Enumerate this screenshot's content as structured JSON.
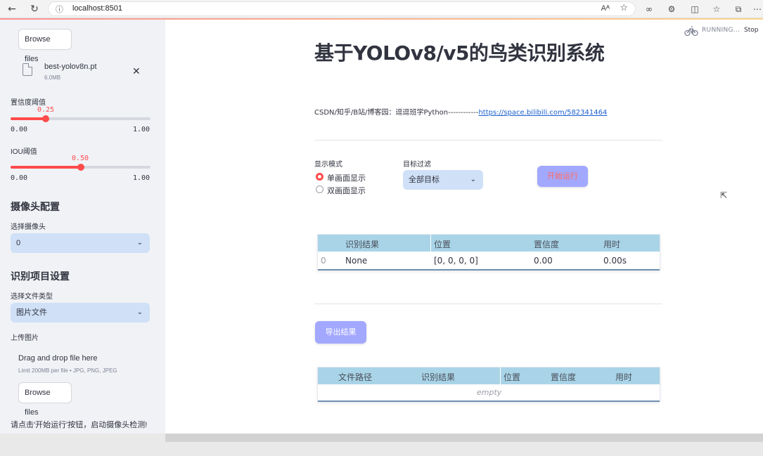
{
  "browser": {
    "url": "localhost:8501"
  },
  "sidebar": {
    "top_browse_label": "Browse files",
    "uploaded_file": {
      "name": "best-yolov8n.pt",
      "size": "6.0MB"
    },
    "confidence": {
      "label": "置信度阈值",
      "value": "0.25",
      "min": "0.00",
      "max": "1.00",
      "fraction": 0.25
    },
    "iou": {
      "label": "IOU阈值",
      "value": "0.50",
      "min": "0.00",
      "max": "1.00",
      "fraction": 0.5
    },
    "camera_heading": "摄像头配置",
    "camera_select_label": "选择摄像头",
    "camera_select_value": "0",
    "project_heading": "识别项目设置",
    "file_type_label": "选择文件类型",
    "file_type_value": "图片文件",
    "upload_label": "上传图片",
    "dropzone_title": "Drag and drop file here",
    "dropzone_limit": "Limit 200MB per file • JPG, PNG, JPEG",
    "bottom_browse_label": "Browse files",
    "info_text": "请点击'开始运行'按钮，启动摄像头检测!"
  },
  "status": {
    "running": "RUNNING...",
    "stop": "Stop"
  },
  "main": {
    "title": "基于YOLOv8/v5的鸟类识别系统",
    "credits_text": "CSDN/知乎/B站/博客园：逗逗班学Python------------",
    "credits_link": "https://space.bilibili.com/582341464",
    "display_mode_label": "显示模式",
    "display_modes": [
      "单画面显示",
      "双画面显示"
    ],
    "target_filter_label": "目标过滤",
    "target_filter_value": "全部目标",
    "run_button": "开始运行",
    "export_button": "导出结果"
  },
  "results_table": {
    "headers": [
      "识别结果",
      "位置",
      "置信度",
      "用时"
    ],
    "rows": [
      {
        "index": "0",
        "result": "None",
        "position": "[0, 0, 0, 0]",
        "confidence": "0.00",
        "time": "0.00s"
      }
    ]
  },
  "export_table": {
    "headers": [
      "文件路径",
      "识别结果",
      "位置",
      "置信度",
      "用时"
    ],
    "empty_text": "empty"
  },
  "colors": {
    "accent": "#ff4b4b",
    "button": "#a3a8ff",
    "header": "#a9d4e8",
    "select": "#cfe0f7"
  }
}
